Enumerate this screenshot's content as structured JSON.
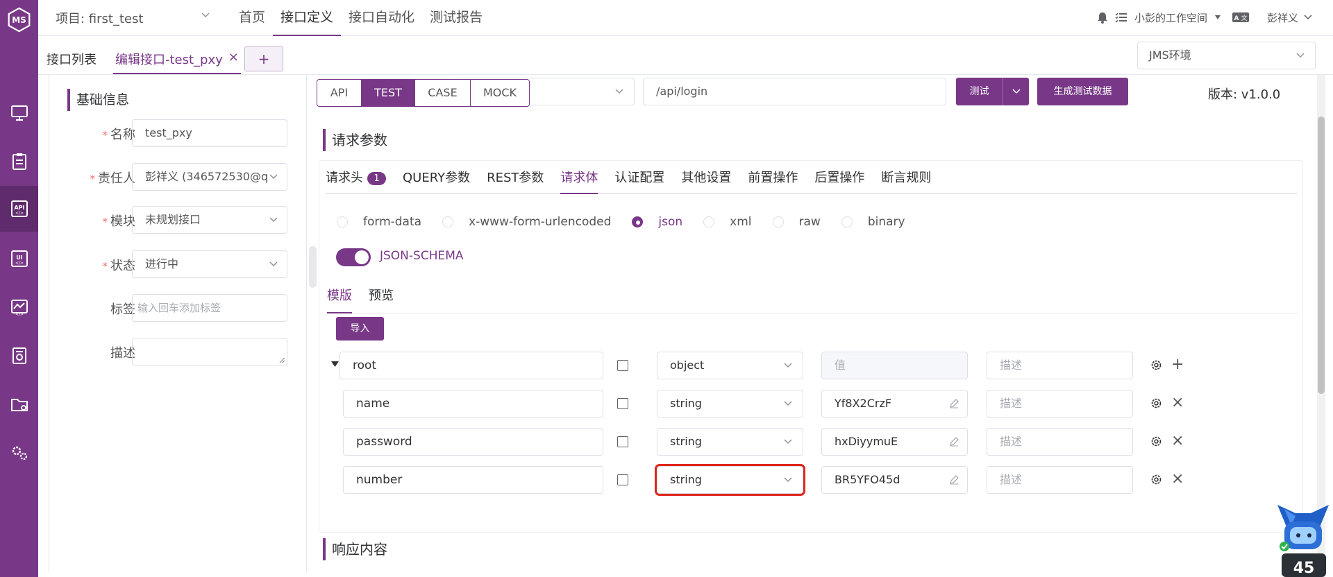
{
  "header": {
    "logo_text": "MS",
    "project_label": "项目: first_test",
    "nav": [
      "首页",
      "接口定义",
      "接口自动化",
      "测试报告"
    ],
    "workspace": "小彭的工作空间",
    "user": "彭祥义"
  },
  "tabs": {
    "list_tab": "接口列表",
    "edit_tab": "编辑接口-test_pxy",
    "close_glyph": "×",
    "add_glyph": "+",
    "environment": "JMS环境"
  },
  "basic_info": {
    "title": "基础信息",
    "required_mark": "*",
    "fields": {
      "name": {
        "label": "名称",
        "value": "test_pxy"
      },
      "owner": {
        "label": "责任人",
        "value": "彭祥义 (346572530@q"
      },
      "module": {
        "label": "模块",
        "value": "未规划接口"
      },
      "status": {
        "label": "状态",
        "value": "进行中"
      },
      "tags": {
        "label": "标签",
        "placeholder": "输入回车添加标签"
      },
      "desc": {
        "label": "描述",
        "value": ""
      }
    }
  },
  "request": {
    "modes": [
      "API",
      "TEST",
      "CASE",
      "MOCK"
    ],
    "active_mode": "TEST",
    "url": "/api/login",
    "test_button": "测试",
    "generate_button": "生成测试数据",
    "version": "版本: v1.0.0",
    "params_title": "请求参数",
    "subtabs": [
      "请求头",
      "QUERY参数",
      "REST参数",
      "请求体",
      "认证配置",
      "其他设置",
      "前置操作",
      "后置操作",
      "断言规则"
    ],
    "header_badge": "1",
    "active_subtab": "请求体",
    "body_types": [
      "form-data",
      "x-www-form-urlencoded",
      "json",
      "xml",
      "raw",
      "binary"
    ],
    "active_body_type": "json",
    "json_schema_label": "JSON-SCHEMA",
    "template_tabs": [
      "模版",
      "预览"
    ],
    "import_button": "导入",
    "schema_rows": [
      {
        "name": "root",
        "type": "object",
        "value": "值",
        "desc": "描述",
        "action": "+"
      },
      {
        "name": "name",
        "type": "string",
        "value": "Yf8X2CrzF",
        "desc": "描述",
        "action": "×"
      },
      {
        "name": "password",
        "type": "string",
        "value": "hxDiyymuE",
        "desc": "描述",
        "action": "×"
      },
      {
        "name": "number",
        "type": "string",
        "value": "BR5YFO45d",
        "desc": "描述",
        "action": "×"
      }
    ],
    "response_title": "响应内容"
  },
  "colors": {
    "brand": "#783887",
    "highlight": "#e1251b"
  }
}
